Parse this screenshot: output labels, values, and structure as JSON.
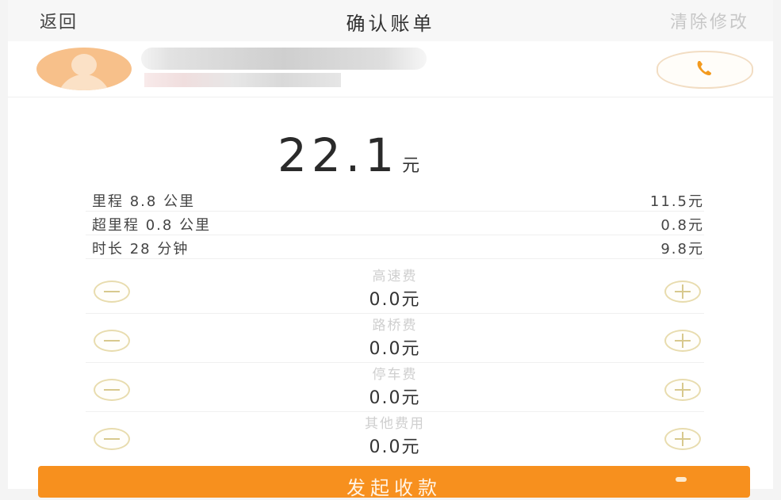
{
  "header": {
    "back_label": "返回",
    "title": "确认账单",
    "clear_label": "清除修改"
  },
  "driver": {
    "avatar_icon": "user-avatar-icon",
    "call_icon": "phone-icon"
  },
  "bill": {
    "total": "22.1",
    "unit": "元",
    "items": [
      {
        "label": "里程 8.8 公里",
        "value": "11.5元"
      },
      {
        "label": "超里程 0.8 公里",
        "value": "0.8元"
      },
      {
        "label": "时长 28 分钟",
        "value": "9.8元"
      }
    ]
  },
  "fees": [
    {
      "name": "高速费",
      "value": "0.0元"
    },
    {
      "name": "路桥费",
      "value": "0.0元"
    },
    {
      "name": "停车费",
      "value": "0.0元"
    },
    {
      "name": "其他费用",
      "value": "0.0元"
    }
  ],
  "action": {
    "submit_label": "发起收款"
  },
  "colors": {
    "accent": "#f7901e",
    "stepper_border": "#e8dcae"
  }
}
